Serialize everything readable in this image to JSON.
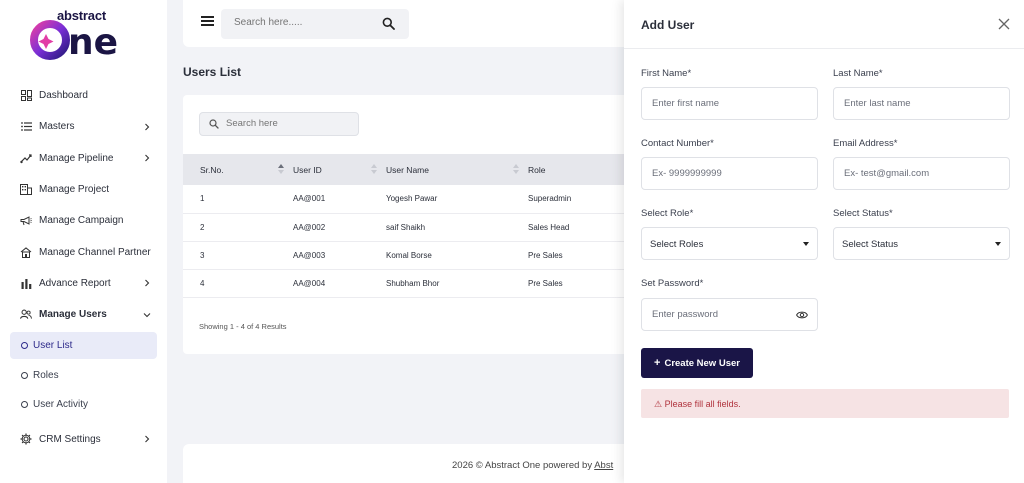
{
  "brand": {
    "name_small": "abstract",
    "name_large": "one",
    "accent": "#7b2fd6",
    "dark": "#1b1544"
  },
  "sidebar": {
    "items": [
      {
        "label": "Dashboard",
        "icon": "dashboard-icon"
      },
      {
        "label": "Masters",
        "icon": "list-icon"
      },
      {
        "label": "Manage Pipeline",
        "icon": "pipeline-icon"
      },
      {
        "label": "Manage Project",
        "icon": "building-icon"
      },
      {
        "label": "Manage Campaign",
        "icon": "megaphone-icon"
      },
      {
        "label": "Manage Channel Partner",
        "icon": "partner-icon"
      },
      {
        "label": "Advance Report",
        "icon": "bar-chart-icon"
      },
      {
        "label": "Manage Users",
        "icon": "users-icon"
      }
    ],
    "sub_items": [
      {
        "label": "User List"
      },
      {
        "label": "Roles"
      },
      {
        "label": "User Activity"
      }
    ],
    "settings": {
      "label": "CRM Settings",
      "icon": "gear-icon"
    }
  },
  "topbar": {
    "search_placeholder": "Search here....."
  },
  "main": {
    "title": "Users List",
    "search_placeholder": "Search here",
    "table": {
      "headers": [
        "Sr.No.",
        "User ID",
        "User Name",
        "Role"
      ],
      "rows": [
        [
          "1",
          "AA@001",
          "Yogesh Pawar",
          "Superadmin"
        ],
        [
          "2",
          "AA@002",
          "saif Shaikh",
          "Sales Head"
        ],
        [
          "3",
          "AA@003",
          "Komal Borse",
          "Pre Sales"
        ],
        [
          "4",
          "AA@004",
          "Shubham Bhor",
          "Pre Sales"
        ]
      ]
    },
    "showing": "Showing 1 - 4 of 4 Results"
  },
  "footer": {
    "text": "2026 © Abstract One powered by ",
    "link": "Abst"
  },
  "drawer": {
    "title": "Add User",
    "first_name": {
      "label": "First Name*",
      "placeholder": "Enter first name"
    },
    "last_name": {
      "label": "Last Name*",
      "placeholder": "Enter last name"
    },
    "contact": {
      "label": "Contact Number*",
      "placeholder": "Ex- 9999999999"
    },
    "email": {
      "label": "Email Address*",
      "placeholder": "Ex- test@gmail.com"
    },
    "role": {
      "label": "Select Role*",
      "value": "Select Roles"
    },
    "status": {
      "label": "Select Status*",
      "value": "Select Status"
    },
    "password": {
      "label": "Set Password*",
      "placeholder": "Enter password"
    },
    "create_button": {
      "plus": "+",
      "label": "Create New User"
    },
    "error": "⚠ Please fill all fields."
  }
}
